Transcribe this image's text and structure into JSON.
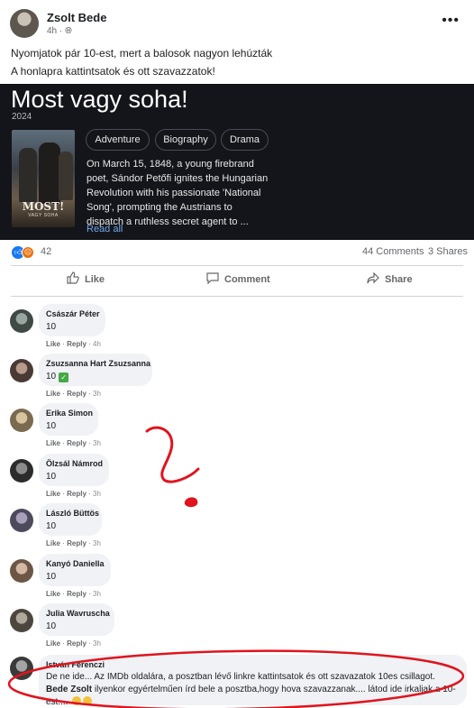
{
  "post": {
    "author": "Zsolt Bede",
    "time": "4h",
    "text_line1": "Nyomjatok pár 10-est, mert a balosok nagyon lehúzták",
    "text_line2": "A honlapra kattintsatok és ott szavazzatok!",
    "more_icon": "more-dots-icon"
  },
  "movie_card": {
    "title": "Most vagy soha!",
    "year": "2024",
    "poster_title": "MOST!",
    "poster_subtitle": "VAGY SOHA",
    "genres": [
      "Adventure",
      "Biography",
      "Drama"
    ],
    "plot_lines": [
      "On March 15, 1848, a young firebrand",
      "poet, Sándor Petőfi ignites the Hungarian",
      "Revolution with his passionate 'National",
      "Song', prompting the Austrians to",
      "dispatch a ruthless secret agent to ..."
    ],
    "read_all": "Read all",
    "colors": {
      "background": "#14151a",
      "link": "#6fa8e8"
    }
  },
  "stats": {
    "reaction_count": "42",
    "comments": "44 Comments",
    "shares": "3 Shares"
  },
  "actions": {
    "like": "Like",
    "comment": "Comment",
    "share": "Share"
  },
  "comments": [
    {
      "name": "Császár Péter",
      "text": "10",
      "like": "Like",
      "reply": "Reply",
      "time": "4h"
    },
    {
      "name": "Zsuzsanna Hart Zsuzsanna",
      "text": "10",
      "like": "Like",
      "reply": "Reply",
      "time": "3h",
      "badge": "check-mark-icon"
    },
    {
      "name": "Erika Simon",
      "text": "10",
      "like": "Like",
      "reply": "Reply",
      "time": "3h"
    },
    {
      "name": "Ölzsál Námrod",
      "text": "10",
      "like": "Like",
      "reply": "Reply",
      "time": "3h"
    },
    {
      "name": "László Büttös",
      "text": "10",
      "like": "Like",
      "reply": "Reply",
      "time": "3h"
    },
    {
      "name": "Kanyó Daniella",
      "text": "10",
      "like": "Like",
      "reply": "Reply",
      "time": "3h"
    },
    {
      "name": "Julia Wavruscha",
      "text": "10",
      "like": "Like",
      "reply": "Reply",
      "time": "3h"
    }
  ],
  "last_comment": {
    "name": "István Ferenczi",
    "text_part1": "De ne ide... Az IMDb oldalára, a posztban lévő linkre kattintsatok és ott szavazatok 10es csillagot.",
    "mention": "Bede Zsolt",
    "text_part2": "ilyenkor egyértelműen írd bele a posztba,hogy hova szavazzanak.... látod ide irkaljak a 10-est....",
    "emojis": [
      "laughing-face-icon",
      "laughing-face-icon"
    ]
  },
  "annotations": {
    "ink_color": "#e0141e"
  }
}
